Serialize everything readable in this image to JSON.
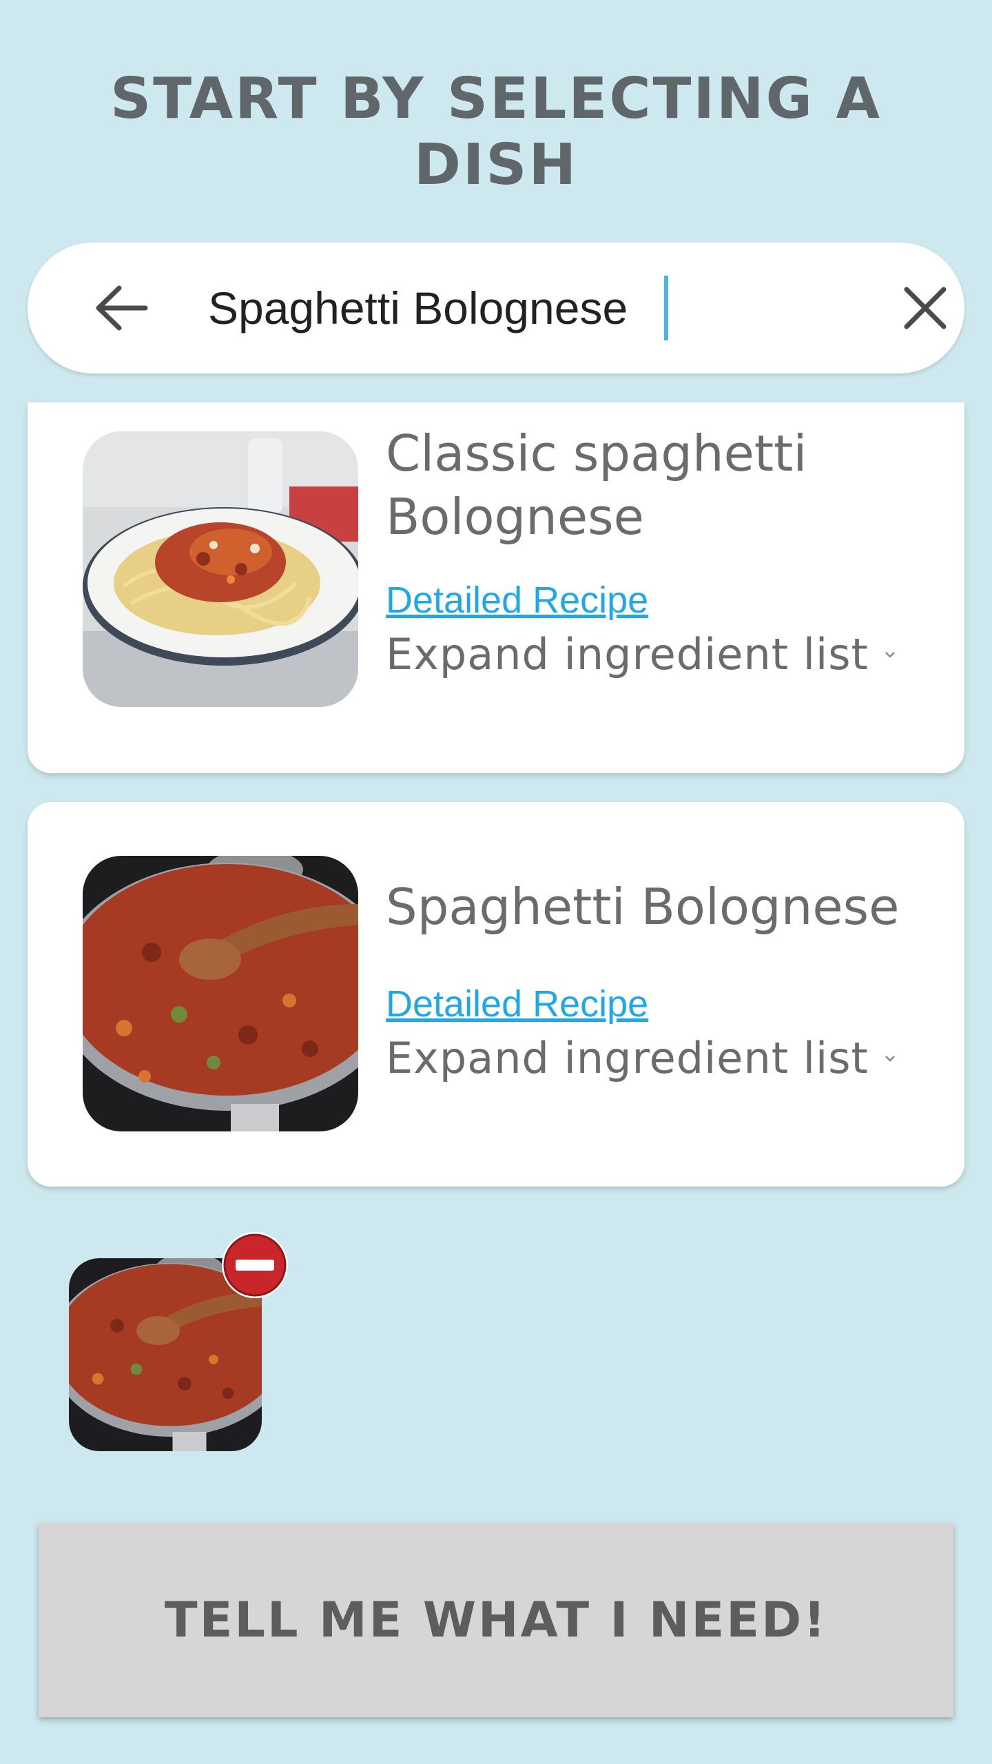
{
  "page": {
    "title": "START BY SELECTING A DISH"
  },
  "search": {
    "value": "Spaghetti Bolognese",
    "back_icon": "arrow-left-icon",
    "clear_icon": "close-icon"
  },
  "results": [
    {
      "title": "Classic spaghetti Bolognese",
      "link_label": "Detailed Recipe",
      "expand_label": "Expand ingredient list",
      "image": "plated-spaghetti-bolognese-photo"
    },
    {
      "title": "Spaghetti Bolognese",
      "link_label": "Detailed Recipe",
      "expand_label": "Expand ingredient list",
      "image": "bolognese-sauce-pan-photo"
    }
  ],
  "selected": {
    "image": "bolognese-sauce-pan-photo",
    "remove_icon": "remove-circle-icon"
  },
  "cta": {
    "label": "TELL ME WHAT I NEED!"
  },
  "colors": {
    "background": "#cde8ee",
    "title": "#5f676b",
    "link": "#21a7e6",
    "button": "#d6d6d6",
    "badge": "#c9262b"
  }
}
